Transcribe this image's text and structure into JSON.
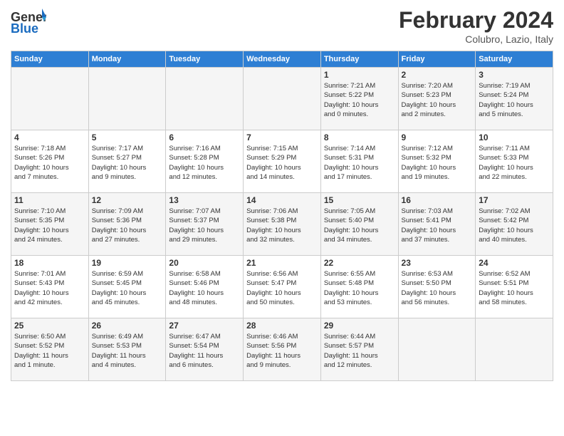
{
  "header": {
    "logo_general": "General",
    "logo_blue": "Blue",
    "month_title": "February 2024",
    "location": "Colubro, Lazio, Italy"
  },
  "days_of_week": [
    "Sunday",
    "Monday",
    "Tuesday",
    "Wednesday",
    "Thursday",
    "Friday",
    "Saturday"
  ],
  "weeks": [
    [
      {
        "day": "",
        "info": ""
      },
      {
        "day": "",
        "info": ""
      },
      {
        "day": "",
        "info": ""
      },
      {
        "day": "",
        "info": ""
      },
      {
        "day": "1",
        "info": "Sunrise: 7:21 AM\nSunset: 5:22 PM\nDaylight: 10 hours\nand 0 minutes."
      },
      {
        "day": "2",
        "info": "Sunrise: 7:20 AM\nSunset: 5:23 PM\nDaylight: 10 hours\nand 2 minutes."
      },
      {
        "day": "3",
        "info": "Sunrise: 7:19 AM\nSunset: 5:24 PM\nDaylight: 10 hours\nand 5 minutes."
      }
    ],
    [
      {
        "day": "4",
        "info": "Sunrise: 7:18 AM\nSunset: 5:26 PM\nDaylight: 10 hours\nand 7 minutes."
      },
      {
        "day": "5",
        "info": "Sunrise: 7:17 AM\nSunset: 5:27 PM\nDaylight: 10 hours\nand 9 minutes."
      },
      {
        "day": "6",
        "info": "Sunrise: 7:16 AM\nSunset: 5:28 PM\nDaylight: 10 hours\nand 12 minutes."
      },
      {
        "day": "7",
        "info": "Sunrise: 7:15 AM\nSunset: 5:29 PM\nDaylight: 10 hours\nand 14 minutes."
      },
      {
        "day": "8",
        "info": "Sunrise: 7:14 AM\nSunset: 5:31 PM\nDaylight: 10 hours\nand 17 minutes."
      },
      {
        "day": "9",
        "info": "Sunrise: 7:12 AM\nSunset: 5:32 PM\nDaylight: 10 hours\nand 19 minutes."
      },
      {
        "day": "10",
        "info": "Sunrise: 7:11 AM\nSunset: 5:33 PM\nDaylight: 10 hours\nand 22 minutes."
      }
    ],
    [
      {
        "day": "11",
        "info": "Sunrise: 7:10 AM\nSunset: 5:35 PM\nDaylight: 10 hours\nand 24 minutes."
      },
      {
        "day": "12",
        "info": "Sunrise: 7:09 AM\nSunset: 5:36 PM\nDaylight: 10 hours\nand 27 minutes."
      },
      {
        "day": "13",
        "info": "Sunrise: 7:07 AM\nSunset: 5:37 PM\nDaylight: 10 hours\nand 29 minutes."
      },
      {
        "day": "14",
        "info": "Sunrise: 7:06 AM\nSunset: 5:38 PM\nDaylight: 10 hours\nand 32 minutes."
      },
      {
        "day": "15",
        "info": "Sunrise: 7:05 AM\nSunset: 5:40 PM\nDaylight: 10 hours\nand 34 minutes."
      },
      {
        "day": "16",
        "info": "Sunrise: 7:03 AM\nSunset: 5:41 PM\nDaylight: 10 hours\nand 37 minutes."
      },
      {
        "day": "17",
        "info": "Sunrise: 7:02 AM\nSunset: 5:42 PM\nDaylight: 10 hours\nand 40 minutes."
      }
    ],
    [
      {
        "day": "18",
        "info": "Sunrise: 7:01 AM\nSunset: 5:43 PM\nDaylight: 10 hours\nand 42 minutes."
      },
      {
        "day": "19",
        "info": "Sunrise: 6:59 AM\nSunset: 5:45 PM\nDaylight: 10 hours\nand 45 minutes."
      },
      {
        "day": "20",
        "info": "Sunrise: 6:58 AM\nSunset: 5:46 PM\nDaylight: 10 hours\nand 48 minutes."
      },
      {
        "day": "21",
        "info": "Sunrise: 6:56 AM\nSunset: 5:47 PM\nDaylight: 10 hours\nand 50 minutes."
      },
      {
        "day": "22",
        "info": "Sunrise: 6:55 AM\nSunset: 5:48 PM\nDaylight: 10 hours\nand 53 minutes."
      },
      {
        "day": "23",
        "info": "Sunrise: 6:53 AM\nSunset: 5:50 PM\nDaylight: 10 hours\nand 56 minutes."
      },
      {
        "day": "24",
        "info": "Sunrise: 6:52 AM\nSunset: 5:51 PM\nDaylight: 10 hours\nand 58 minutes."
      }
    ],
    [
      {
        "day": "25",
        "info": "Sunrise: 6:50 AM\nSunset: 5:52 PM\nDaylight: 11 hours\nand 1 minute."
      },
      {
        "day": "26",
        "info": "Sunrise: 6:49 AM\nSunset: 5:53 PM\nDaylight: 11 hours\nand 4 minutes."
      },
      {
        "day": "27",
        "info": "Sunrise: 6:47 AM\nSunset: 5:54 PM\nDaylight: 11 hours\nand 6 minutes."
      },
      {
        "day": "28",
        "info": "Sunrise: 6:46 AM\nSunset: 5:56 PM\nDaylight: 11 hours\nand 9 minutes."
      },
      {
        "day": "29",
        "info": "Sunrise: 6:44 AM\nSunset: 5:57 PM\nDaylight: 11 hours\nand 12 minutes."
      },
      {
        "day": "",
        "info": ""
      },
      {
        "day": "",
        "info": ""
      }
    ]
  ]
}
